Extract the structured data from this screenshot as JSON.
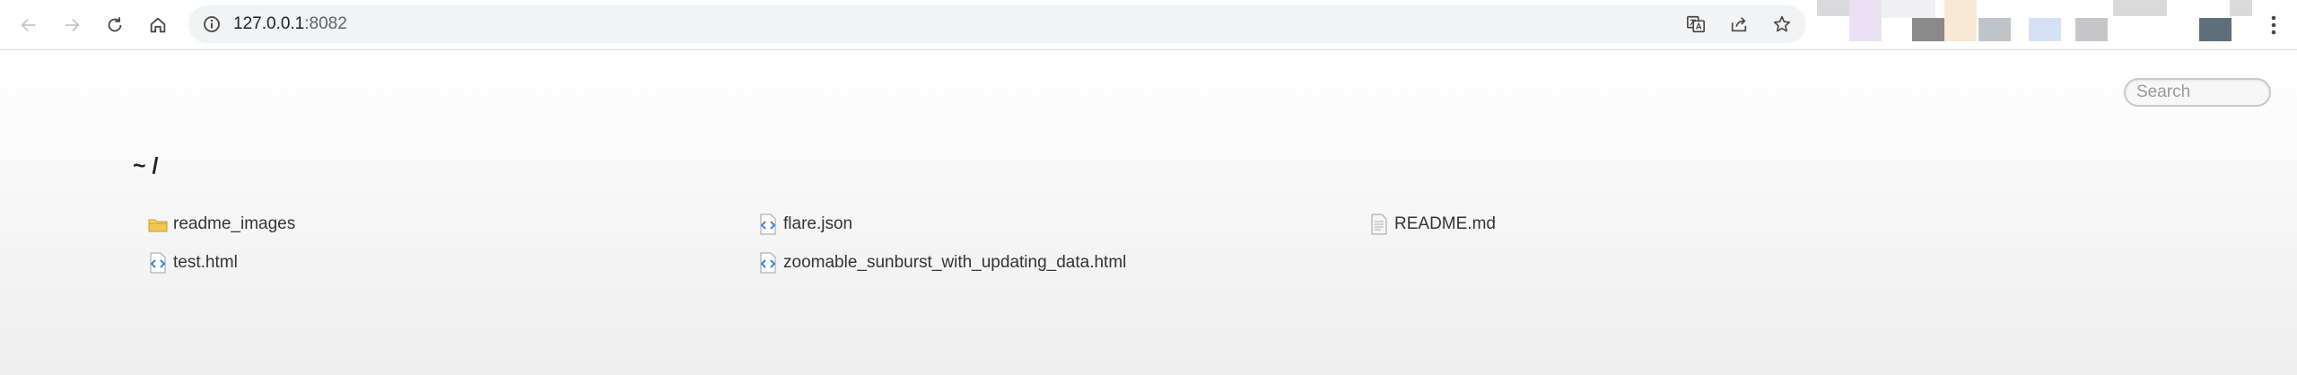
{
  "browser": {
    "url_host": "127.0.0.1",
    "url_port": ":8082",
    "icons": [
      "back-icon",
      "forward-icon",
      "reload-icon",
      "home-icon",
      "info-icon",
      "translate-icon",
      "share-icon",
      "star-icon",
      "menu-icon"
    ],
    "extension_colors": [
      "#d9d9de",
      "#ebe0f1",
      "#f0f0f2",
      "#8a8a8a",
      "#f8e7d2",
      "#bfc4ca",
      "#d6e1f6",
      "#c6c6c8",
      "#dadada",
      "#5f6f79"
    ]
  },
  "page": {
    "search_placeholder": "Search",
    "breadcrumb": "~ /",
    "files": [
      {
        "name": "readme_images",
        "type": "folder"
      },
      {
        "name": "flare.json",
        "type": "code"
      },
      {
        "name": "README.md",
        "type": "text"
      },
      {
        "name": "test.html",
        "type": "code"
      },
      {
        "name": "zoomable_sunburst_with_updating_data.html",
        "type": "code"
      }
    ]
  },
  "colors": {
    "folder": "#f3c74d",
    "code_icon": "#3c86d0",
    "text_color": "#333333"
  }
}
